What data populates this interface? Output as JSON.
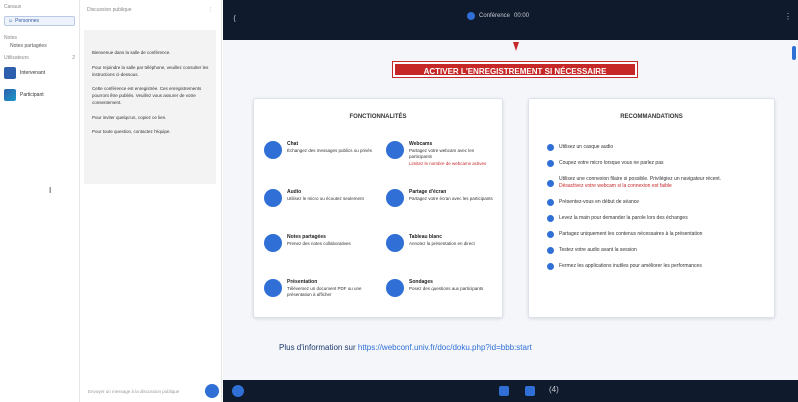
{
  "left": {
    "top_label": "Canaux",
    "tab_label": "Personnes",
    "section_notes": "Notes",
    "shared_notes": "Notes partagées",
    "section_users": "Utilisateurs",
    "users_count": "2",
    "users": [
      {
        "name": "Intervenant"
      },
      {
        "name": "Participant"
      }
    ],
    "cursor": "I"
  },
  "mid": {
    "title": "Discussion publique",
    "menu": "⋮",
    "messages": [
      "Bienvenue dans la salle de conférence.",
      "Pour rejoindre la salle par téléphone, veuillez consulter les instructions ci-dessous.",
      "Cette conférence est enregistrée. Ces enregistrements pourront être publiés. Veuillez vous assurer de votre consentement.",
      "Pour inviter quelqu'un, copiez ce lien.",
      "Pour toute question, contactez l'équipe."
    ],
    "input_placeholder": "Envoyer un message à la discussion publique"
  },
  "presentation": {
    "top_title": "Conférence",
    "top_extra": "00:00",
    "record_banner": "ACTIVER L'ENREGISTREMENT SI NÉCESSAIRE",
    "features_title": "FONCTIONNALITÉS",
    "features": [
      {
        "title": "Chat",
        "text": "Échangez des messages publics ou privés",
        "red": ""
      },
      {
        "title": "Webcams",
        "text": "Partagez votre webcam avec les participants",
        "red": "Limitez le nombre de webcams actives"
      },
      {
        "title": "Audio",
        "text": "Utilisez le micro ou écoutez seulement",
        "red": ""
      },
      {
        "title": "Partage d'écran",
        "text": "Partagez votre écran avec les participants",
        "red": ""
      },
      {
        "title": "Notes partagées",
        "text": "Prenez des notes collaboratives",
        "red": ""
      },
      {
        "title": "Tableau blanc",
        "text": "Annotez la présentation en direct",
        "red": ""
      },
      {
        "title": "Présentation",
        "text": "Téléversez un document PDF ou une présentation à afficher",
        "red": ""
      },
      {
        "title": "Sondages",
        "text": "Posez des questions aux participants",
        "red": ""
      }
    ],
    "recs_title": "RECOMMANDATIONS",
    "recommendations": [
      {
        "text": "Utilisez un casque audio",
        "red": ""
      },
      {
        "text": "Coupez votre micro lorsque vous ne parlez pas",
        "red": ""
      },
      {
        "text": "Utilisez une connexion filaire si possible. Privilégiez un navigateur récent.",
        "red": "Désactivez votre webcam si la connexion est faible"
      },
      {
        "text": "Présentez-vous en début de séance",
        "red": ""
      },
      {
        "text": "Levez la main pour demander la parole lors des échanges",
        "red": ""
      },
      {
        "text": "Partagez uniquement les contenus nécessaires à la présentation",
        "red": ""
      },
      {
        "text": "Testez votre audio avant la session",
        "red": ""
      },
      {
        "text": "Fermez les applications inutiles pour améliorer les performances",
        "red": ""
      }
    ],
    "more_prefix": "Plus d'information sur",
    "more_link": "https://webconf.univ.fr/doc/doku.php?id=bbb:start",
    "bottom_count": "(4)"
  },
  "colors": {
    "accent": "#2f6fd6",
    "dark": "#0f1a2c",
    "alert": "#c62828"
  }
}
